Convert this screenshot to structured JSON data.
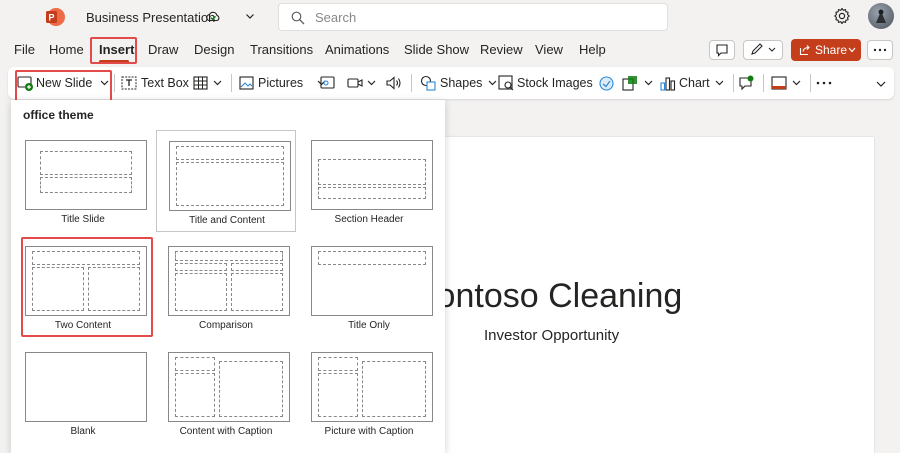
{
  "titlebar": {
    "doc_title": "Business Presentation",
    "search_placeholder": "Search"
  },
  "menu": {
    "tabs": [
      "File",
      "Home",
      "Insert",
      "Draw",
      "Design",
      "Transitions",
      "Animations",
      "Slide Show",
      "Review",
      "View",
      "Help"
    ],
    "active_tab": "Insert",
    "share_label": "Share"
  },
  "ribbon": {
    "new_slide": "New Slide",
    "text_box": "Text Box",
    "pictures": "Pictures",
    "shapes": "Shapes",
    "stock_images": "Stock Images",
    "chart": "Chart"
  },
  "dropdown": {
    "heading": "office theme",
    "layouts": [
      {
        "name": "Title Slide"
      },
      {
        "name": "Title and Content"
      },
      {
        "name": "Section Header"
      },
      {
        "name": "Two Content"
      },
      {
        "name": "Comparison"
      },
      {
        "name": "Title Only"
      },
      {
        "name": "Blank"
      },
      {
        "name": "Content with Caption"
      },
      {
        "name": "Picture with Caption"
      }
    ],
    "selected_layout": "Title and Content"
  },
  "slide": {
    "title": "Contoso Cleaning",
    "subtitle": "Investor Opportunity"
  },
  "colors": {
    "accent": "#c43e1c",
    "highlight": "#e34a4a",
    "app_icon": "#c43e1c"
  }
}
